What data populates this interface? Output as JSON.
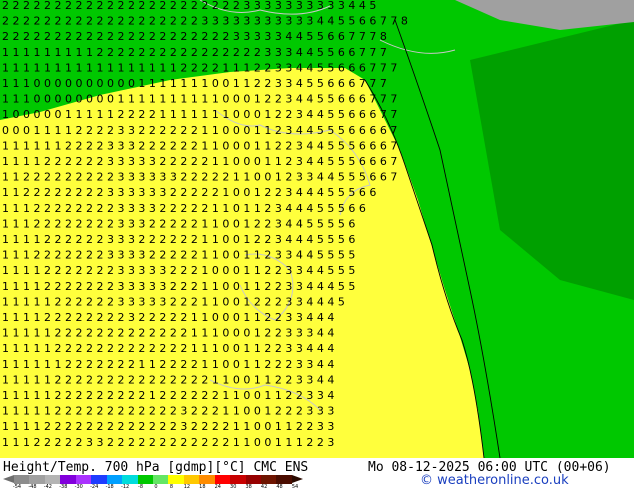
{
  "title": {
    "left": "Height/Temp. 700 hPa [gdmp][°C] CMC ENS",
    "right": "Mo 08-12-2025 06:00 UTC (00+06)"
  },
  "credit": "© weatheronline.co.uk",
  "legend": {
    "ticks": [
      "-54",
      "-48",
      "-42",
      "-38",
      "-30",
      "-24",
      "-18",
      "-12",
      "-8",
      "0",
      "8",
      "12",
      "18",
      "24",
      "30",
      "38",
      "42",
      "48",
      "54"
    ],
    "colors": [
      "#8c8c8c",
      "#a0a0a0",
      "#b4b4b4",
      "#8200dc",
      "#aa32ff",
      "#1e3cff",
      "#00a0ff",
      "#00dcdc",
      "#00c800",
      "#64e664",
      "#ffff00",
      "#ffc800",
      "#ff8c00",
      "#ff0000",
      "#c80000",
      "#960000",
      "#6e1400",
      "#4a0c00"
    ]
  },
  "colors": {
    "warm_zone": "#ffff3c",
    "cool_zone_light": "#00c800",
    "cool_zone_dark": "#00a000",
    "grey_zone": "#a0a0a0",
    "contour": "#000000",
    "border": "#c8c8c8"
  },
  "labels": {
    "rows": [
      "2 2 2 2 2 2 2 2 2 2 2 2 2 2 2 2 2 2 2 2 2 2 2 3 3 3 3 3 3 3 3 3 3 4 4 5",
      "2 2 2 2 2 2 2 2 2 2 2 2 2 2 2 2 2 2 2 3 3 3 3 3 3 3 3 3 3 3 4 4 5 5 6 6 7 7 8",
      "2 2 2 2 2 2 2 2 2 2 2 2 2 2 2 2 2 2 2 2 2 2 3 3 3 3 3 4 4 5 5 6 6 7 7 7 8",
      "1 1 1 1 1 1 1 1 1 2 2 2 2 2 2 2 2 2 2 2 2 2 2 2 2 3 3 3 4 4 5 5 6 6 7 7 7",
      "1 1 1 1 1 1 1 1 1 1 1 1 1 1 1 1 1 2 2 2 2 1 1 1 2 2 3 3 4 4 5 5 6 6 6 7 7 7",
      "1 1 1 0 0 0 0 0 0 0 0 0 0 1 1 1 1 1 1 1 0 0 1 1 2 2 3 3 4 5 5 6 6 6 7 7 7",
      "1 1 1 0 0 0 0 0 0 0 0 1 1 1 1 1 1 1 1 1 1 0 0 0 1 2 2 3 4 4 5 5 6 6 6 7 7 7",
      "1 0 0 0 0 0 1 1 1 1 1 2 2 2 2 1 1 1 1 1 1 1 0 0 0 1 2 2 3 4 4 5 5 6 6 6 7 7",
      "0 0 0 1 1 1 1 2 2 2 2 3 3 2 2 2 2 2 2 1 1 0 0 0 1 1 2 3 4 4 5 5 5 6 6 6 6 7",
      "1 1 1 1 1 1 2 2 2 2 3 3 3 2 2 2 2 2 2 1 1 0 0 0 1 1 2 2 3 4 4 5 5 5 6 6 6 7",
      "1 1 1 1 2 2 2 2 2 2 3 3 3 3 3 2 2 2 2 2 1 1 0 0 0 1 1 2 3 4 4 5 5 5 6 6 6 7",
      "1 1 2 2 2 2 2 2 2 2 2 3 3 3 3 3 3 2 2 2 2 2 1 1 0 0 1 2 3 3 4 4 5 5 5 6 6 7",
      "1 1 2 2 2 2 2 2 2 2 3 3 3 3 3 3 2 2 2 2 2 1 0 0 1 2 2 3 4 4 4 5 5 5 6 6",
      "1 1 1 2 2 2 2 2 2 2 2 3 3 3 3 2 2 2 2 2 1 1 0 1 1 2 3 4 4 4 5 5 5 6 6",
      "1 1 1 2 2 2 2 2 2 2 2 3 3 3 2 2 2 2 2 1 1 0 0 1 2 2 3 4 4 5 5 5 5 6",
      "1 1 1 1 2 2 2 2 2 2 3 3 3 2 2 2 2 2 2 1 1 0 0 1 2 2 3 4 4 4 5 5 5 6",
      "1 1 1 2 2 2 2 2 2 2 3 3 3 3 2 2 2 2 2 1 1 0 0 1 1 2 3 3 4 4 5 5 5 5",
      "1 1 1 1 2 2 2 2 2 2 2 3 3 3 3 3 2 2 2 1 0 0 0 1 1 2 2 3 3 4 4 5 5 5",
      "1 1 1 1 2 2 2 2 2 2 2 3 3 3 3 3 2 2 2 1 1 0 0 1 1 2 2 3 3 4 4 4 5 5",
      "1 1 1 1 1 2 2 2 2 2 2 3 3 3 3 3 2 2 2 1 1 0 0 1 2 2 2 3 3 4 4 4 5",
      "1 1 1 1 2 2 2 2 2 2 2 2 3 2 2 2 2 2 1 1 0 0 0 1 1 2 2 3 3 4 4 4",
      "1 1 1 1 1 2 2 2 2 2 2 2 2 2 2 2 2 2 1 1 1 0 0 0 1 2 2 3 3 3 4 4",
      "1 1 1 1 1 2 2 2 2 2 2 2 2 2 2 2 2 2 1 1 1 0 0 1 1 2 2 3 3 4 4 4",
      "1 1 1 1 1 1 2 2 2 2 2 2 2 1 1 2 2 2 2 1 1 0 0 1 1 2 2 2 3 3 4 4",
      "1 1 1 1 1 2 2 2 2 2 2 2 2 2 2 2 2 2 2 2 1 1 0 0 1 1 2 2 3 3 4 4",
      "1 1 1 1 1 2 2 2 2 2 2 2 2 2 1 2 2 2 2 2 2 1 1 0 0 1 1 2 2 3 3 4",
      "1 1 1 1 1 2 2 2 2 2 2 2 2 2 2 2 2 3 2 2 2 1 1 0 0 1 2 2 2 3 3 3",
      "1 1 1 1 2 2 2 2 2 2 2 2 2 2 2 2 2 3 2 2 2 2 1 1 0 0 1 1 2 2 3 3",
      "1 1 1 2 2 2 2 2 3 3 2 2 2 2 2 2 2 2 2 2 2 2 1 1 0 0 1 1 1 2 2 3"
    ]
  }
}
